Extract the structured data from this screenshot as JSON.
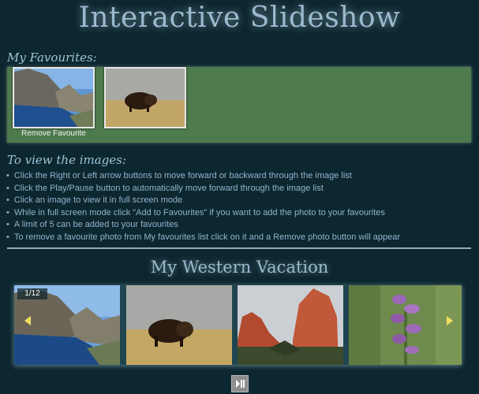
{
  "page": {
    "title": "Interactive Slideshow"
  },
  "favourites": {
    "heading": "My Favourites:",
    "items": [
      {
        "image": "lake-cliffs-photo",
        "action_label": "Remove Favourite"
      },
      {
        "image": "bison-photo"
      }
    ]
  },
  "instructions": {
    "heading": "To view the images:",
    "items": [
      "Click the Right or Left arrow buttons to move forward or backward through the image list",
      "Click the Play/Pause button to automatically move forward through the image list",
      "Click an image to view it in full screen mode",
      "While in full screen mode click \"Add to Favourites\" if you want to add the photo to your favourites",
      "A limit of 5 can be added to your favourites",
      "To remove a favourite photo from My favourites list click on it and a Remove photo button will appear"
    ]
  },
  "gallery": {
    "title": "My Western Vacation",
    "counter": "1/12",
    "slides": [
      {
        "image": "lake-cliffs-photo"
      },
      {
        "image": "bison-photo"
      },
      {
        "image": "red-rocks-photo"
      },
      {
        "image": "purple-flower-photo"
      }
    ],
    "prev_icon": "left-arrow-icon",
    "next_icon": "right-arrow-icon",
    "play_icon": "play-pause-icon"
  },
  "colors": {
    "background": "#0d2730",
    "favourites_panel": "#4e7b4d",
    "heading_text": "#9ab9ce",
    "arrow": "#f0e060"
  }
}
